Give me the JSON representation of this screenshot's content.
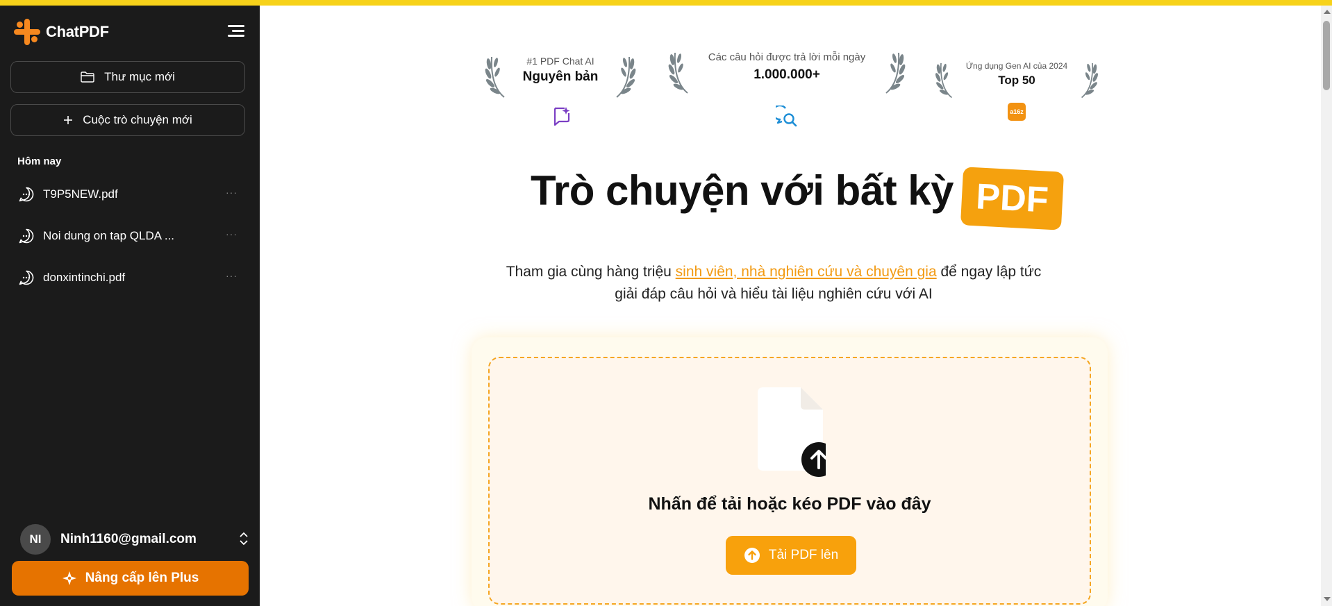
{
  "colors": {
    "accent": "#f5a10e",
    "upgrade": "#e67300",
    "sidebar_bg": "#1b1b1b",
    "link": "#f29a12",
    "top_bar": "#f7d21a"
  },
  "sidebar": {
    "brand": {
      "name": "ChatPDF",
      "logo_icon": "chatpdf-logo-icon"
    },
    "menu_icon": "menu-lines-icon",
    "new_folder_label": "Thư mục mới",
    "new_chat_label": "Cuộc trò chuyện mới",
    "section_today": "Hôm nay",
    "chats": [
      {
        "label": "T9P5NEW.pdf",
        "more": "···"
      },
      {
        "label": "Noi dung on tap QLDA ...",
        "more": "···"
      },
      {
        "label": "donxintinchi.pdf",
        "more": "···"
      }
    ],
    "user": {
      "initials": "NI",
      "email": "Ninh1160@gmail.com"
    },
    "upgrade_label": "Nâng cấp lên Plus"
  },
  "awards": [
    {
      "small": "#1 PDF Chat AI",
      "big": "Nguyên bản",
      "icon": "chat-sparkle-icon"
    },
    {
      "small": "Các câu hỏi được trả lời mỗi ngày",
      "big": "1.000.000+",
      "icon": "search-chat-icon"
    },
    {
      "small": "Ứng dụng Gen AI của 2024",
      "big": "Top 50",
      "icon": "a16z-logo-icon",
      "icon_text": "a16z"
    }
  ],
  "hero": {
    "headline": "Trò chuyện với bất kỳ",
    "badge": "PDF",
    "sub_before": "Tham gia cùng hàng triệu ",
    "sub_link": "sinh viên, nhà nghiên cứu và chuyên gia",
    "sub_after": " để ngay lập tức",
    "sub_line2": "giải đáp câu hỏi và hiểu tài liệu nghiên cứu với AI"
  },
  "upload": {
    "drop_text": "Nhấn để tải hoặc kéo PDF vào đây",
    "button_label": "Tải PDF lên"
  }
}
